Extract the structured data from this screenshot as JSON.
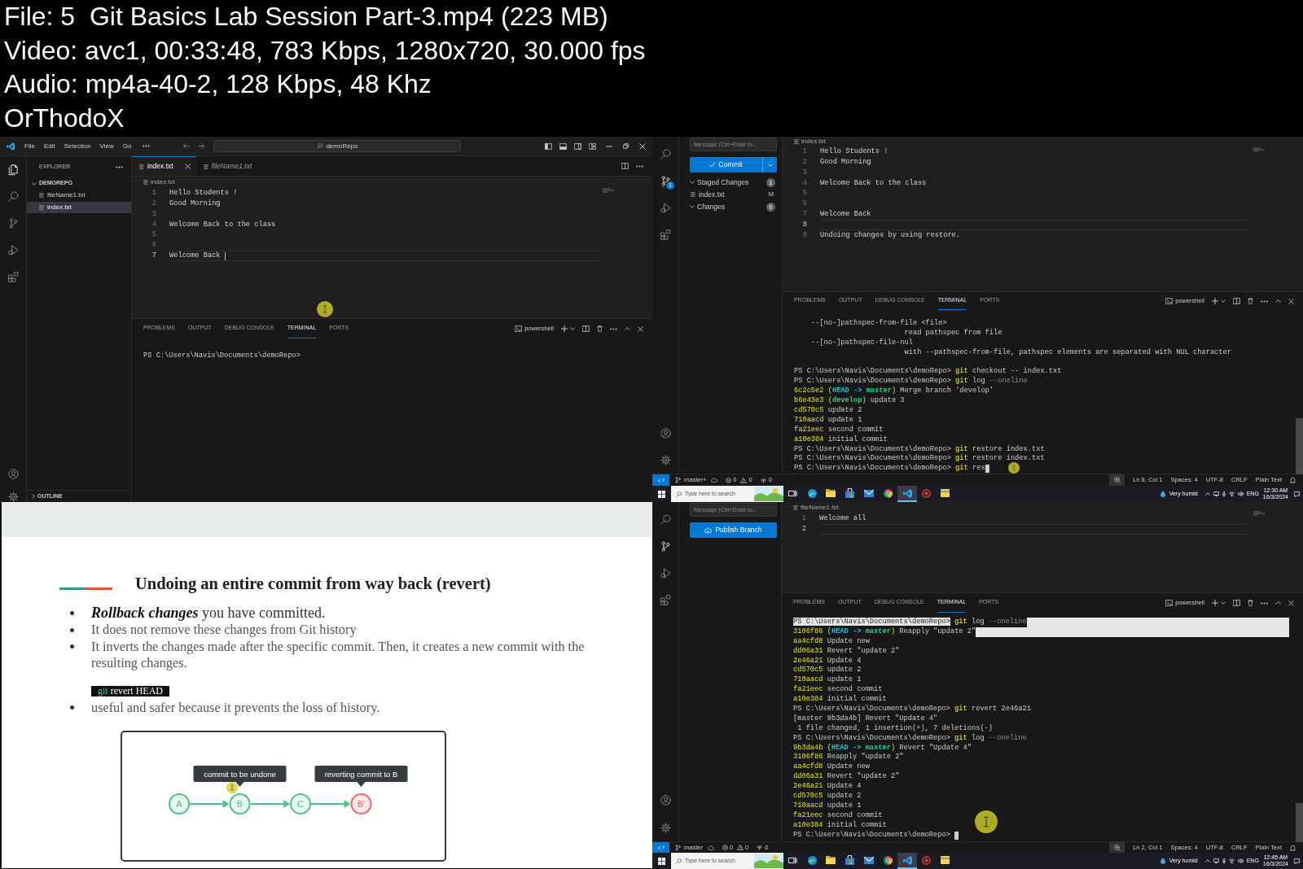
{
  "file_info": {
    "lines": [
      "File: 5  Git Basics Lab Session Part-3.mp4 (223 MB)",
      "Video: avc1, 00:33:48, 783 Kbps, 1280x720, 30.000 fps",
      "Audio: mp4a-40-2, 128 Kbps, 48 Khz",
      "OrThodoX"
    ]
  },
  "frames": [
    {
      "kind": "vscode",
      "title_bar": {
        "menus": [
          "File",
          "Edit",
          "Selection",
          "View",
          "Go"
        ],
        "search": "demoRepo"
      },
      "activity_bar": [
        {
          "kind": "explorer",
          "selected": true
        },
        {
          "kind": "search",
          "selected": false
        },
        {
          "kind": "scm",
          "selected": false
        },
        {
          "kind": "run",
          "selected": false
        },
        {
          "kind": "extensions",
          "selected": false
        }
      ],
      "sidebar": {
        "kind": "explorer",
        "title": "EXPLORER",
        "folder": {
          "name": "DEMOREPO",
          "expanded": true,
          "files": [
            {
              "name": "fileName1.txt",
              "selected": false
            },
            {
              "name": "index.txt",
              "selected": true
            }
          ]
        },
        "outline": {
          "name": "OUTLINE",
          "expanded": false
        }
      },
      "tabs": [
        {
          "label": "index.txt",
          "selected": true,
          "preview": false
        },
        {
          "label": "fileName1.txt",
          "selected": false,
          "preview": true
        }
      ],
      "breadcrumb": "index.txt",
      "editor": {
        "cursor": true,
        "lines": [
          {
            "number": "1",
            "text": "Hello Students !",
            "current": false
          },
          {
            "number": "2",
            "text": "Good Morning",
            "current": false
          },
          {
            "number": "3",
            "current": false
          },
          {
            "number": "4",
            "text": "Welcome Back to the class",
            "current": false
          },
          {
            "number": "5",
            "current": false
          },
          {
            "number": "6",
            "current": false
          },
          {
            "number": "7",
            "text": "Welcome Back",
            "current": true
          }
        ]
      },
      "panel": {
        "tabs": [
          {
            "label": "PROBLEMS",
            "selected": false
          },
          {
            "label": "OUTPUT",
            "selected": false
          },
          {
            "label": "DEBUG CONSOLE",
            "selected": false
          },
          {
            "label": "TERMINAL",
            "selected": true
          },
          {
            "label": "PORTS",
            "selected": false
          }
        ],
        "shell": "powershell",
        "terminal": {
          "blocks": [
            [
              {
                "segments": [
                  {
                    "text": "PS C:\\Users\\Navis\\Documents\\demoRepo>",
                    "kind": "text"
                  }
                ]
              }
            ]
          ]
        }
      }
    },
    {
      "kind": "vscode",
      "activity_bar": [
        {
          "kind": "search",
          "selected": false
        },
        {
          "kind": "scm",
          "selected": true,
          "badge": "1"
        },
        {
          "kind": "run",
          "selected": false
        },
        {
          "kind": "extensions",
          "selected": false
        }
      ],
      "sidebar": {
        "kind": "scm",
        "message": {
          "placeholder": "Message (Ctrl+Enter to..."
        },
        "action": {
          "kind": "commit",
          "label": "Commit"
        },
        "groups": [
          {
            "name": "Staged Changes",
            "expanded": true,
            "count": "1",
            "files": [
              {
                "name": "index.txt",
                "status": "M"
              }
            ]
          },
          {
            "name": "Changes",
            "expanded": true,
            "count": "0"
          }
        ]
      },
      "breadcrumb": "index.txt",
      "editor": {
        "lines": [
          {
            "number": "1",
            "text": "Hello Students !",
            "current": false
          },
          {
            "number": "2",
            "text": "Good Morning",
            "current": false
          },
          {
            "number": "3",
            "current": false
          },
          {
            "number": "4",
            "text": "Welcome Back to the class",
            "current": false
          },
          {
            "number": "5",
            "current": false
          },
          {
            "number": "6",
            "current": false
          },
          {
            "number": "7",
            "text": "Welcome Back",
            "current": false
          },
          {
            "number": "8",
            "current": true
          },
          {
            "number": "9",
            "text": "Undoing changes by using restore.",
            "current": false
          }
        ]
      },
      "panel": {
        "tabs": [
          {
            "label": "PROBLEMS",
            "selected": false
          },
          {
            "label": "OUTPUT",
            "selected": false
          },
          {
            "label": "DEBUG CONSOLE",
            "selected": false
          },
          {
            "label": "TERMINAL",
            "selected": true
          },
          {
            "label": "PORTS",
            "selected": false
          }
        ],
        "shell": "powershell",
        "terminal": {
          "cursor": true,
          "blocks": [
            [
              {
                "segments": [
                  {
                    "text": "    --[no-]pathspec-from-file <file>",
                    "kind": "text"
                  }
                ]
              },
              {
                "segments": [
                  {
                    "text": "                          read pathspec from file",
                    "kind": "text"
                  }
                ]
              },
              {
                "segments": [
                  {
                    "text": "    --[no-]pathspec-file-nul",
                    "kind": "text"
                  }
                ]
              },
              {
                "segments": [
                  {
                    "text": "                          with --pathspec-from-file, pathspec elements are separated with NUL character",
                    "kind": "text"
                  }
                ]
              }
            ],
            [
              {
                "segments": [
                  {
                    "text": "PS C:\\Users\\Navis\\Documents\\demoRepo>",
                    "kind": "text"
                  },
                  {
                    "text": " git",
                    "kind": "command"
                  },
                  {
                    "text": " checkout -- index.txt",
                    "kind": "text"
                  }
                ]
              },
              {
                "segments": [
                  {
                    "text": "PS C:\\Users\\Navis\\Documents\\demoRepo>",
                    "kind": "text"
                  },
                  {
                    "text": " git",
                    "kind": "command"
                  },
                  {
                    "text": " log ",
                    "kind": "text"
                  },
                  {
                    "text": "--oneline",
                    "kind": "option"
                  }
                ]
              },
              {
                "segments": [
                  {
                    "text": "6c2c5e2 (",
                    "kind": "hash"
                  },
                  {
                    "text": "HEAD -> ",
                    "kind": "head"
                  },
                  {
                    "text": "master",
                    "kind": "branch"
                  },
                  {
                    "text": ")",
                    "kind": "hash"
                  },
                  {
                    "text": " Merge branch 'develop'",
                    "kind": "text"
                  }
                ]
              },
              {
                "segments": [
                  {
                    "text": "b6e43e3 (",
                    "kind": "hash"
                  },
                  {
                    "text": "develop",
                    "kind": "branch"
                  },
                  {
                    "text": ")",
                    "kind": "hash"
                  },
                  {
                    "text": " update 3",
                    "kind": "text"
                  }
                ]
              },
              {
                "segments": [
                  {
                    "text": "cd570c5",
                    "kind": "hash"
                  },
                  {
                    "text": " update 2",
                    "kind": "text"
                  }
                ]
              },
              {
                "segments": [
                  {
                    "text": "710aacd",
                    "kind": "hash"
                  },
                  {
                    "text": " update 1",
                    "kind": "text"
                  }
                ]
              },
              {
                "segments": [
                  {
                    "text": "fa21eec",
                    "kind": "hash"
                  },
                  {
                    "text": " second commit",
                    "kind": "text"
                  }
                ]
              },
              {
                "segments": [
                  {
                    "text": "a10e384",
                    "kind": "hash"
                  },
                  {
                    "text": " initial commit",
                    "kind": "text"
                  }
                ]
              },
              {
                "segments": [
                  {
                    "text": "PS C:\\Users\\Navis\\Documents\\demoRepo>",
                    "kind": "text"
                  },
                  {
                    "text": " git",
                    "kind": "command"
                  },
                  {
                    "text": " restore index.txt",
                    "kind": "text"
                  }
                ]
              },
              {
                "segments": [
                  {
                    "text": "PS C:\\Users\\Navis\\Documents\\demoRepo>",
                    "kind": "text"
                  },
                  {
                    "text": " git",
                    "kind": "command"
                  },
                  {
                    "text": " restore index.txt",
                    "kind": "text"
                  }
                ]
              },
              {
                "segments": [
                  {
                    "text": "PS C:\\Users\\Navis\\Documents\\demoRepo>",
                    "kind": "text"
                  },
                  {
                    "text": " git",
                    "kind": "command"
                  },
                  {
                    "text": " res",
                    "kind": "text"
                  }
                ]
              }
            ]
          ]
        }
      },
      "status_bar": {
        "branch": "master+",
        "errors": "0",
        "warnings": "0",
        "ports": "0",
        "items": [
          "Ln 8, Col 1",
          "Spaces: 4",
          "UTF-8",
          "CRLF",
          "Plain Text"
        ]
      },
      "taskbar": {
        "search": {
          "placeholder": "Type here to search"
        },
        "apps": [
          {
            "kind": "taskview",
            "selected": false
          },
          {
            "kind": "browser",
            "selected": false
          },
          {
            "kind": "folder",
            "selected": false
          },
          {
            "kind": "store",
            "selected": false
          },
          {
            "kind": "mail",
            "selected": false
          },
          {
            "kind": "chrome",
            "selected": false
          },
          {
            "kind": "code",
            "selected": true
          },
          {
            "kind": "recorder",
            "selected": false
          },
          {
            "kind": "notes",
            "selected": false
          }
        ],
        "weather": "Very humid",
        "language": "ENG",
        "time": "12:30 AM",
        "date": "16/3/2024"
      }
    },
    {
      "kind": "slide",
      "title": "Undoing an entire commit from way back (revert)",
      "items": [
        {
          "kind": "bullet",
          "text": "**Rollback changes** you have committed."
        },
        {
          "kind": "bullet",
          "text": "It does not remove these changes from Git history"
        },
        {
          "kind": "bullet",
          "text": "It inverts the changes made after the specific commit. Then, it creates a new commit with the resulting changes."
        },
        {
          "kind": "code",
          "segments": [
            {
              "text": "git",
              "kind": "keyword"
            },
            {
              "text": " revert HEAD",
              "kind": "text"
            }
          ]
        },
        {
          "kind": "bullet",
          "text": "useful and safer because it prevents the loss of history."
        }
      ],
      "diagram": {
        "nodes": [
          {
            "label": "A",
            "color": "#4cc38a"
          },
          {
            "label": "B",
            "color": "#4cc38a",
            "callout": "commit to be undone"
          },
          {
            "label": "C",
            "color": "#4cc38a"
          },
          {
            "label": "B'",
            "color": "#e5686b",
            "callout": "reverting commit to B"
          }
        ]
      }
    },
    {
      "kind": "vscode",
      "activity_bar": [
        {
          "kind": "search",
          "selected": false
        },
        {
          "kind": "scm",
          "selected": true
        },
        {
          "kind": "run",
          "selected": false
        },
        {
          "kind": "extensions",
          "selected": false
        }
      ],
      "sidebar": {
        "kind": "scm",
        "message": {
          "placeholder": "Message (Ctrl+Enter to..."
        },
        "action": {
          "kind": "publish",
          "label": "Publish Branch"
        }
      },
      "breadcrumb": "fileName1.txt",
      "editor": {
        "lines": [
          {
            "number": "1",
            "text": "Welcome all",
            "current": false
          },
          {
            "number": "2",
            "current": true
          }
        ]
      },
      "panel": {
        "tabs": [
          {
            "label": "PROBLEMS",
            "selected": false
          },
          {
            "label": "OUTPUT",
            "selected": false
          },
          {
            "label": "DEBUG CONSOLE",
            "selected": false
          },
          {
            "label": "TERMINAL",
            "selected": true
          },
          {
            "label": "PORTS",
            "selected": false
          }
        ],
        "shell": "powershell",
        "terminal": {
          "cursor": true,
          "blocks": [
            [
              {
                "selected": true,
                "segments": [
                  {
                    "text": "PS C:\\Users\\Navis\\Documents\\demoRepo>",
                    "kind": "selection"
                  },
                  {
                    "text": " git",
                    "kind": "command"
                  },
                  {
                    "text": " log ",
                    "kind": "text"
                  },
                  {
                    "text": "--oneline",
                    "kind": "option"
                  }
                ]
              },
              {
                "selected": true,
                "segments": [
                  {
                    "text": "3106f86 (",
                    "kind": "hash"
                  },
                  {
                    "text": "HEAD -> ",
                    "kind": "head"
                  },
                  {
                    "text": "master",
                    "kind": "branch"
                  },
                  {
                    "text": ")",
                    "kind": "hash"
                  },
                  {
                    "text": " Reapply \"update 2\"",
                    "kind": "text"
                  }
                ]
              },
              {
                "selected": false,
                "segments": [
                  {
                    "text": "aa4cfd8",
                    "kind": "hash"
                  },
                  {
                    "text": " Update new",
                    "kind": "text"
                  }
                ]
              },
              {
                "selected": false,
                "segments": [
                  {
                    "text": "dd06a31",
                    "kind": "hash"
                  },
                  {
                    "text": " Revert \"update 2\"",
                    "kind": "text"
                  }
                ]
              },
              {
                "selected": false,
                "segments": [
                  {
                    "text": "2e46a21",
                    "kind": "hash"
                  },
                  {
                    "text": " Update 4",
                    "kind": "text"
                  }
                ]
              },
              {
                "selected": false,
                "segments": [
                  {
                    "text": "cd570c5",
                    "kind": "hash"
                  },
                  {
                    "text": " update 2",
                    "kind": "text"
                  }
                ]
              },
              {
                "selected": false,
                "segments": [
                  {
                    "text": "710aacd",
                    "kind": "hash"
                  },
                  {
                    "text": " update 1",
                    "kind": "text"
                  }
                ]
              },
              {
                "selected": false,
                "segments": [
                  {
                    "text": "fa21eec",
                    "kind": "hash"
                  },
                  {
                    "text": " second commit",
                    "kind": "text"
                  }
                ]
              },
              {
                "selected": false,
                "segments": [
                  {
                    "text": "a10e384",
                    "kind": "hash"
                  },
                  {
                    "text": " initial commit",
                    "kind": "text"
                  }
                ]
              },
              {
                "selected": false,
                "segments": [
                  {
                    "text": "PS C:\\Users\\Navis\\Documents\\demoRepo>",
                    "kind": "text"
                  },
                  {
                    "text": " git",
                    "kind": "command"
                  },
                  {
                    "text": " revert 2e46a21",
                    "kind": "text"
                  }
                ]
              },
              {
                "selected": false,
                "segments": [
                  {
                    "text": "[master 9b3da4b] Revert \"Update 4\"",
                    "kind": "text"
                  }
                ]
              },
              {
                "selected": false,
                "segments": [
                  {
                    "text": " 1 file changed, 1 insertion(+), 7 deletions(-)",
                    "kind": "text"
                  }
                ]
              },
              {
                "selected": false,
                "segments": [
                  {
                    "text": "PS C:\\Users\\Navis\\Documents\\demoRepo>",
                    "kind": "text"
                  },
                  {
                    "text": " git",
                    "kind": "command"
                  },
                  {
                    "text": " log ",
                    "kind": "text"
                  },
                  {
                    "text": "--oneline",
                    "kind": "option"
                  }
                ]
              },
              {
                "selected": false,
                "segments": [
                  {
                    "text": "9b3da4b (",
                    "kind": "hash"
                  },
                  {
                    "text": "HEAD -> ",
                    "kind": "head"
                  },
                  {
                    "text": "master",
                    "kind": "branch"
                  },
                  {
                    "text": ")",
                    "kind": "hash"
                  },
                  {
                    "text": " Revert \"Update 4\"",
                    "kind": "text"
                  }
                ]
              },
              {
                "selected": false,
                "segments": [
                  {
                    "text": "3106f86",
                    "kind": "hash"
                  },
                  {
                    "text": " Reapply \"update 2\"",
                    "kind": "text"
                  }
                ]
              },
              {
                "selected": false,
                "segments": [
                  {
                    "text": "aa4cfd8",
                    "kind": "hash"
                  },
                  {
                    "text": " Update new",
                    "kind": "text"
                  }
                ]
              },
              {
                "selected": false,
                "segments": [
                  {
                    "text": "dd06a31",
                    "kind": "hash"
                  },
                  {
                    "text": " Revert \"update 2\"",
                    "kind": "text"
                  }
                ]
              },
              {
                "selected": false,
                "segments": [
                  {
                    "text": "2e46a21",
                    "kind": "hash"
                  },
                  {
                    "text": " Update 4",
                    "kind": "text"
                  }
                ]
              },
              {
                "selected": false,
                "segments": [
                  {
                    "text": "cd570c5",
                    "kind": "hash"
                  },
                  {
                    "text": " update 2",
                    "kind": "text"
                  }
                ]
              },
              {
                "selected": false,
                "segments": [
                  {
                    "text": "710aacd",
                    "kind": "hash"
                  },
                  {
                    "text": " update 1",
                    "kind": "text"
                  }
                ]
              },
              {
                "selected": false,
                "segments": [
                  {
                    "text": "fa21eec",
                    "kind": "hash"
                  },
                  {
                    "text": " second commit",
                    "kind": "text"
                  }
                ]
              },
              {
                "selected": false,
                "segments": [
                  {
                    "text": "a10e384",
                    "kind": "hash"
                  },
                  {
                    "text": " initial commit",
                    "kind": "text"
                  }
                ]
              },
              {
                "selected": false,
                "segments": [
                  {
                    "text": "PS C:\\Users\\Navis\\Documents\\demoRepo> ",
                    "kind": "text"
                  }
                ]
              }
            ]
          ]
        }
      },
      "status_bar": {
        "branch": "master",
        "errors": "0",
        "warnings": "0",
        "ports": "0",
        "items": [
          "Ln 2, Col 1",
          "Spaces: 4",
          "UTF-8",
          "CRLF",
          "Plain Text"
        ]
      },
      "taskbar": {
        "search": {
          "placeholder": "Type here to search"
        },
        "apps": [
          {
            "kind": "taskview",
            "selected": false
          },
          {
            "kind": "browser",
            "selected": false
          },
          {
            "kind": "folder",
            "selected": false
          },
          {
            "kind": "store",
            "selected": false
          },
          {
            "kind": "mail",
            "selected": false
          },
          {
            "kind": "chrome",
            "selected": false
          },
          {
            "kind": "code",
            "selected": true
          },
          {
            "kind": "recorder",
            "selected": false
          },
          {
            "kind": "notes",
            "selected": false
          }
        ],
        "weather": "Very humid",
        "language": "ENG",
        "time": "12:45 AM",
        "date": "16/3/2024"
      }
    }
  ]
}
